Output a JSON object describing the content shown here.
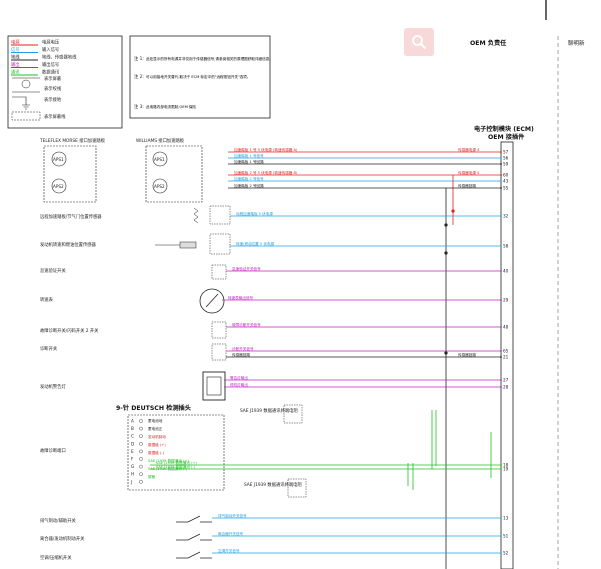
{
  "header": {
    "oem_responsibility": "OEM 负责任",
    "right_title": "聊明新",
    "ecm_title": "电子控制模块 (ECM)",
    "ecm_subtitle": "OEM 接插件"
  },
  "legend": {
    "colors": [
      {
        "label": "电源",
        "desc": "电源电压",
        "color": "#e02020"
      },
      {
        "label": "信号",
        "desc": "输入信号",
        "color": "#20a0e0"
      },
      {
        "label": "地线",
        "desc": "地线、传感器地线",
        "color": "#222222"
      },
      {
        "label": "输出",
        "desc": "输出信号",
        "color": "#c020c0"
      },
      {
        "label": "通讯",
        "desc": "数据通讯",
        "color": "#20c020"
      }
    ],
    "symbols": [
      "表示屏蔽",
      "表示绞线",
      "表示接地",
      "表示屏蔽线"
    ]
  },
  "notes": [
    {
      "num": "注 1:",
      "text": "此处显示的所有电源并非仅用于传感器信号,请参阅相关的原理图获取详细信息。"
    },
    {
      "num": "注 2:",
      "text": "可以用接地开关替代,取决于 ECM 标定中的\"远程按钮开关\"选项。"
    },
    {
      "num": "注 3:",
      "text": "此电路内部电流限制,OEM 保险"
    }
  ],
  "sensors": {
    "telefex_title": "TELEFLEX MORSE 接口加速踏板",
    "williams_title": "WILLIAMS 接口加速踏板",
    "aps1": "APS1",
    "aps2": "APS2",
    "remote_throttle": "远程加速踏板/节气门位置传感器",
    "remote_pto": "发动机转速和燃油位置传感器",
    "idle_validation": "怠速验证开关",
    "tachometer": "转速表",
    "diag_switch": "故障诊断开关/闪码开关 2 开关",
    "vsa_switch": "诊断开关",
    "ecm_warning_lamp": "发动机警告灯",
    "deutsch": "9-针 DEUTSCH 检测插头",
    "datalink_label": "故障诊断端口",
    "j1939_a": "SAE J1939 数据通讯终端电阻",
    "j1939_b": "SAE J1939 数据通讯终端电阻",
    "switch_1": "排气制动/辅助开关",
    "switch_2": "离合器/发动机制动开关",
    "switch_3": "空调/压缩机开关"
  },
  "wires": [
    {
      "label": "加速踏板 1 号 5 伏电源 (转速传感器 A)",
      "pin": "57",
      "color": "#e02020",
      "note": "传感器电源 4"
    },
    {
      "label": "加速踏板 1 号信号",
      "pin": "56",
      "color": "#20a0e0"
    },
    {
      "label": "加速踏板 1 号回路",
      "pin": "59",
      "color": "#222222"
    },
    {
      "label": "加速踏板 2 号 5 伏电源 (转速传感器 B)",
      "pin": "60",
      "color": "#e02020",
      "note": "传感器电源 5"
    },
    {
      "label": "加速踏板 2 号信号",
      "pin": "43",
      "color": "#20a0e0"
    },
    {
      "label": "加速踏板 2 号回路",
      "pin": "55",
      "color": "#222222",
      "note": "传感器回路"
    },
    {
      "label": "远程加速踏板 5 伏电源",
      "pin": "32",
      "color": "#20a0e0"
    },
    {
      "label": "转速/燃油位置 5 伏电源",
      "pin": "58",
      "color": "#20a0e0"
    },
    {
      "label": "怠速验证开关信号",
      "pin": "40",
      "color": "#c020c0"
    },
    {
      "label": "转速表输出信号",
      "pin": "29",
      "color": "#c020c0"
    },
    {
      "label": "故障诊断开关信号",
      "pin": "48",
      "color": "#c020c0"
    },
    {
      "label": "诊断开关信号",
      "pin": "65",
      "color": "#c020c0"
    },
    {
      "label": "传感器回路",
      "pin": "21",
      "color": "#222222",
      "note": "传感器回路"
    },
    {
      "label": "警告灯输出",
      "pin": "27",
      "color": "#c020c0"
    },
    {
      "label": "停机灯输出",
      "pin": "28",
      "color": "#c020c0"
    },
    {
      "label": "SAE J1939 数据通讯 (+)",
      "pin": "18",
      "color": "#20c020"
    },
    {
      "label": "SAE J1939 数据通讯 (-)",
      "pin": "19",
      "color": "#20c020"
    },
    {
      "label": "排气制动开关信号",
      "pin": "13",
      "color": "#20a0e0"
    },
    {
      "label": "离合器开关信号",
      "pin": "51",
      "color": "#20a0e0"
    },
    {
      "label": "空调开关信号",
      "pin": "52",
      "color": "#20a0e0"
    }
  ],
  "deutsch_pins": [
    "A",
    "B",
    "C",
    "D",
    "E",
    "F",
    "G",
    "H",
    "J"
  ],
  "deutsch_labels": [
    "蓄电池地",
    "蓄电池正",
    "发动机制动",
    "数据链 (+)",
    "数据链 (-)",
    "SAE J1939 数据通讯 (+)",
    "SAE J1939 数据通讯 (-)",
    "屏蔽"
  ]
}
